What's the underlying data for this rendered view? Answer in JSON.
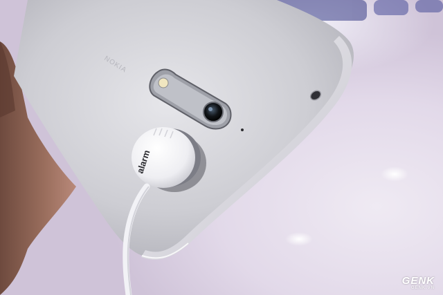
{
  "photo": {
    "subject": "white smartphone rear close-up with alarm security tether",
    "background_color": "#dcd3e4"
  },
  "sensor": {
    "label": "alarm"
  },
  "watermark": {
    "brand": "GENK",
    "site": "GENK.VN"
  }
}
